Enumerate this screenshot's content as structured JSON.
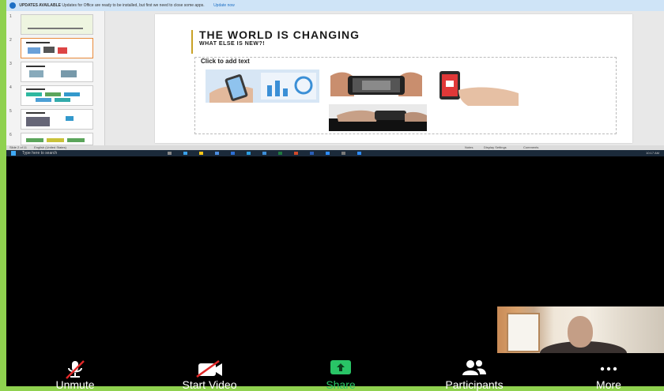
{
  "update_bar": {
    "badge": "UPDATES AVAILABLE",
    "message": "Updates for Office are ready to be installed, but first we need to close some apps.",
    "action": "Update now"
  },
  "thumbnails": [
    {
      "num": "1"
    },
    {
      "num": "2"
    },
    {
      "num": "3"
    },
    {
      "num": "4"
    },
    {
      "num": "5"
    },
    {
      "num": "6"
    }
  ],
  "slide": {
    "title": "THE WORLD IS CHANGING",
    "subtitle": "WHAT ELSE IS NEW?!",
    "placeholder": "Click to add text"
  },
  "status_bar": {
    "left": "Slide 2 of 11",
    "language": "English (United States)",
    "notes": "Notes",
    "display": "Display Settings",
    "comments": "Comments"
  },
  "taskbar": {
    "search_placeholder": "Type here to search",
    "tray_time": "10:17 AM"
  },
  "meeting_toolbar": {
    "unmute": "Unmute",
    "start_video": "Start Video",
    "share": "Share",
    "participants": "Participants",
    "more": "More"
  },
  "colors": {
    "background_border": "#8fd14f",
    "share_green": "#29c466",
    "muted_red": "#e02828",
    "slide_accent": "#c9a227"
  }
}
